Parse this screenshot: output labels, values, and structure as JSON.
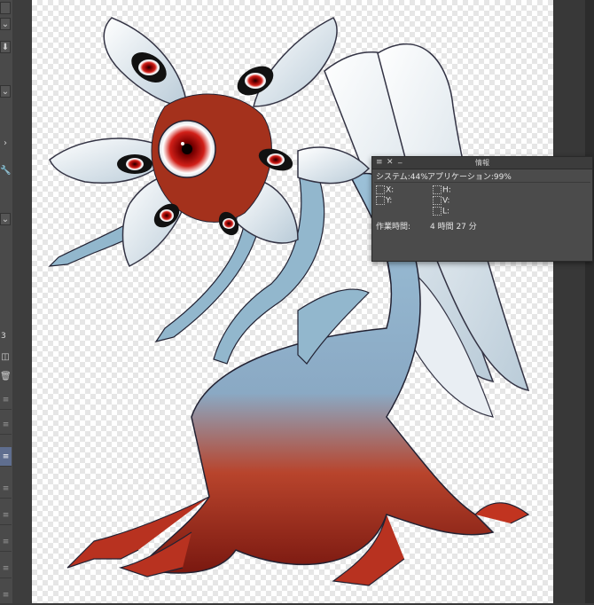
{
  "info_panel": {
    "title": "情報",
    "close_glyph": "✕",
    "minimize_glyph": "_",
    "menu_glyph": "≡",
    "system_label": "システム:44%",
    "app_label": "アプリケーション:99%",
    "x_label": "X:",
    "y_label": "Y:",
    "h_label": "H:",
    "v_label": "V:",
    "l_label": "L:",
    "work_time_label": "作業時間:",
    "work_time_value": "4 時間 27 分"
  },
  "left_strip": {
    "spin_value": "3",
    "icons": [
      "chevron-down-icon",
      "download-icon",
      "chevron-right-icon",
      "wrench-icon",
      "spin-icon",
      "trash-icon",
      "layer-menu-icon"
    ]
  },
  "colors": {
    "panel_bg": "#4b4b4b",
    "selected_row": "#5f6e8f",
    "skin": "#8fb4cf",
    "red": "#c62a14"
  }
}
